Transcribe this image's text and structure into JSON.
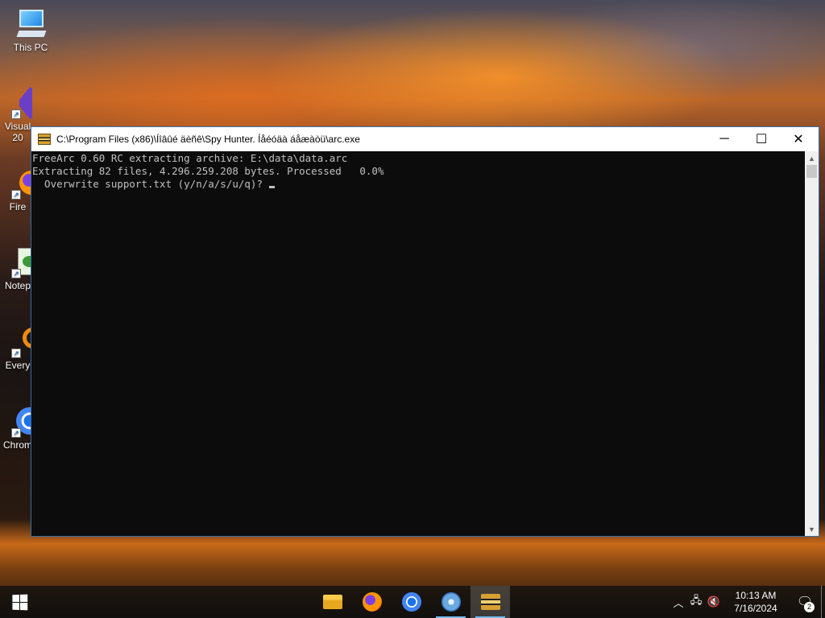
{
  "desktop": {
    "icons": [
      {
        "label": "This PC",
        "icon": "computer-icon"
      },
      {
        "label": "Visual\n20",
        "icon": "visual-studio-icon"
      },
      {
        "label": "Fire",
        "icon": "firefox-icon"
      },
      {
        "label": "Notep",
        "icon": "notepad-icon"
      },
      {
        "label": "Every",
        "icon": "everything-icon"
      },
      {
        "label": "Chrom",
        "icon": "chrome-icon"
      }
    ]
  },
  "window": {
    "title": "C:\\Program Files (x86)\\Íîâûé äèñê\\Spy Hunter. Íåéóäà áåæàòü\\arc.exe",
    "controls": {
      "minimize": "─",
      "maximize": "☐",
      "close": "✕"
    },
    "console_lines": [
      "FreeArc 0.60 RC extracting archive: E:\\data\\data.arc",
      "Extracting 82 files, 4.296.259.208 bytes. Processed   0.0%",
      "  Overwrite support.txt (y/n/a/s/u/q)? "
    ]
  },
  "taskbar": {
    "apps": [
      {
        "name": "File Explorer",
        "icon": "folder-icon",
        "active": false
      },
      {
        "name": "Firefox",
        "icon": "firefox-icon",
        "active": false
      },
      {
        "name": "Chrome",
        "icon": "chrome-icon",
        "active": false
      },
      {
        "name": "Disc tool",
        "icon": "disc-icon",
        "active": false
      },
      {
        "name": "FreeArc",
        "icon": "archive-icon",
        "active": true
      }
    ],
    "tray": {
      "time": "10:13 AM",
      "date": "7/16/2024",
      "notification_count": "2"
    }
  }
}
